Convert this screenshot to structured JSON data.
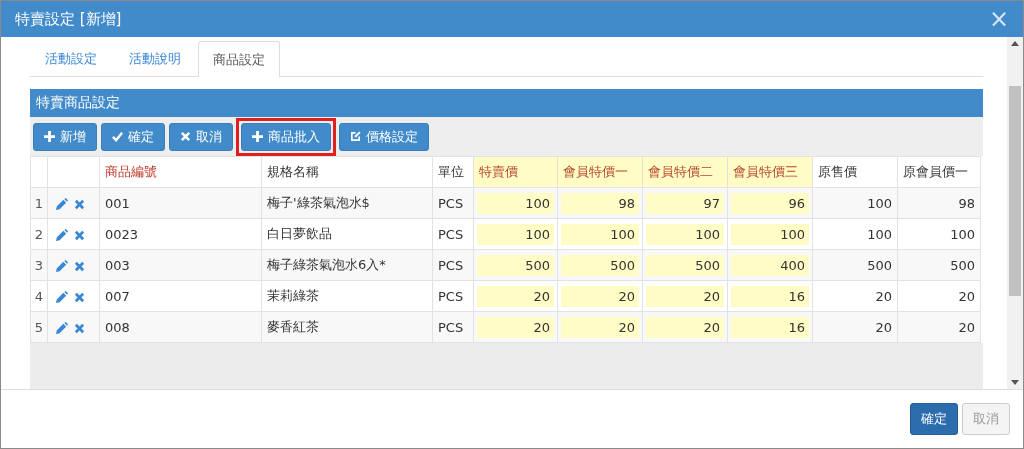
{
  "window": {
    "title": "特賣設定 [新增]",
    "close": "×"
  },
  "tabs": [
    {
      "label": "活動設定",
      "selected": false
    },
    {
      "label": "活動說明",
      "selected": false
    },
    {
      "label": "商品設定",
      "selected": true
    }
  ],
  "panel": {
    "title": "特賣商品設定"
  },
  "toolbar": [
    {
      "label": "新增",
      "kind": "plus",
      "highlighted": false
    },
    {
      "label": "確定",
      "kind": "check",
      "highlighted": false
    },
    {
      "label": "取消",
      "kind": "times",
      "highlighted": false
    },
    {
      "label": "商品批入",
      "kind": "plus",
      "highlighted": true
    },
    {
      "label": "價格設定",
      "kind": "edit",
      "highlighted": false
    }
  ],
  "table": {
    "columns": [
      {
        "label": "商品編號",
        "kind": "key"
      },
      {
        "label": "規格名稱",
        "kind": "plain"
      },
      {
        "label": "單位",
        "kind": "plain"
      },
      {
        "label": "特賣價",
        "kind": "special"
      },
      {
        "label": "會員特價一",
        "kind": "special"
      },
      {
        "label": "會員特價二",
        "kind": "special"
      },
      {
        "label": "會員特價三",
        "kind": "special"
      },
      {
        "label": "原售價",
        "kind": "plain"
      },
      {
        "label": "原會員價一",
        "kind": "plain"
      }
    ],
    "rows": [
      {
        "number": "1",
        "cells": [
          "001",
          "梅子'綠茶氣泡水$",
          "PCS",
          "100",
          "98",
          "97",
          "96",
          "100",
          "98"
        ]
      },
      {
        "number": "2",
        "cells": [
          "0023",
          "白日夢飲品",
          "PCS",
          "100",
          "100",
          "100",
          "100",
          "100",
          "100"
        ]
      },
      {
        "number": "3",
        "cells": [
          "003",
          "梅子綠茶氣泡水6入*",
          "PCS",
          "500",
          "500",
          "500",
          "400",
          "500",
          "500"
        ]
      },
      {
        "number": "4",
        "cells": [
          "007",
          "茉莉綠茶",
          "PCS",
          "20",
          "20",
          "20",
          "16",
          "20",
          "20"
        ]
      },
      {
        "number": "5",
        "cells": [
          "008",
          "麥香紅茶",
          "PCS",
          "20",
          "20",
          "20",
          "16",
          "20",
          "20"
        ]
      }
    ]
  },
  "footer": [
    {
      "label": "確定",
      "kind": "primary"
    },
    {
      "label": "取消",
      "kind": "default"
    }
  ]
}
